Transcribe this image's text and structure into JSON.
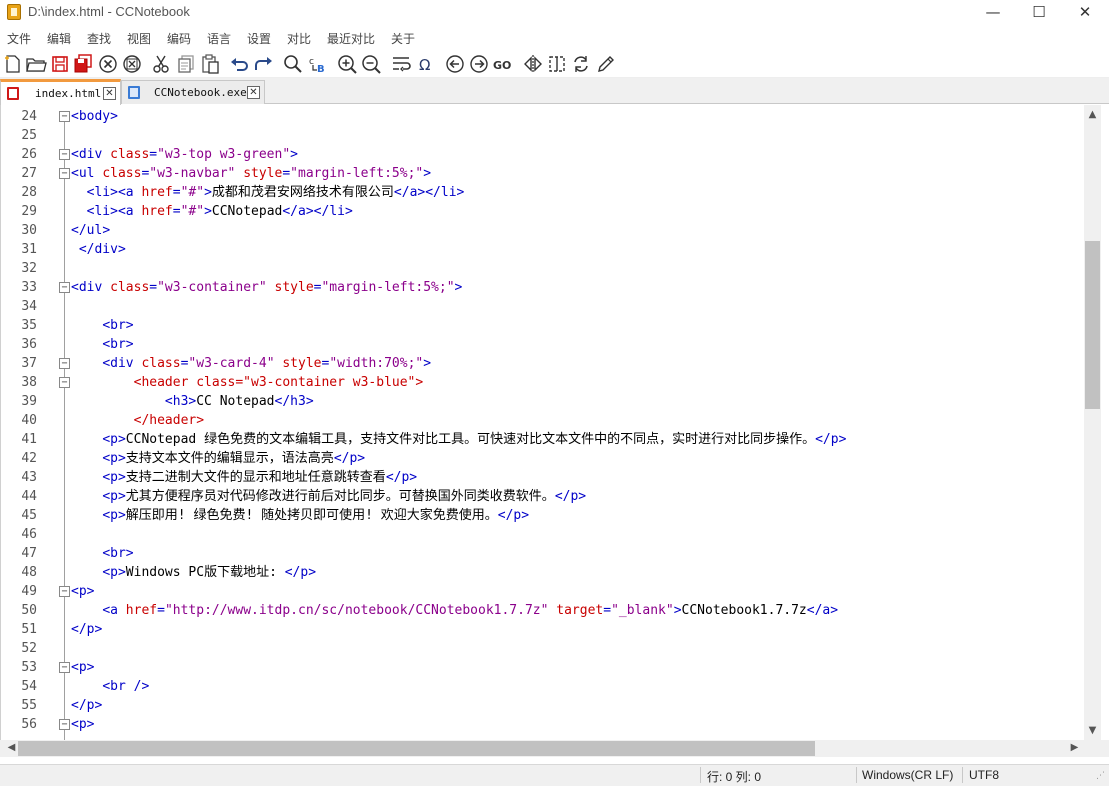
{
  "window": {
    "title": "D:\\index.html - CCNotebook",
    "minimize": "—",
    "maximize": "☐",
    "close": "✕"
  },
  "menu": {
    "items": [
      "文件",
      "编辑",
      "查找",
      "视图",
      "编码",
      "语言",
      "设置",
      "对比",
      "最近对比",
      "关于"
    ]
  },
  "toolbar": {
    "icons": [
      "new-file-icon",
      "open-folder-icon",
      "save-icon",
      "save-all-icon",
      "close-icon",
      "close-all-icon",
      "cut-icon",
      "copy-icon",
      "paste-icon",
      "undo-icon",
      "redo-icon",
      "find-icon",
      "replace-icon",
      "zoom-in-icon",
      "zoom-out-icon",
      "word-wrap-icon",
      "special-char-icon",
      "back-icon",
      "forward-icon",
      "goto-icon",
      "compare-icon",
      "select-icon",
      "refresh-icon",
      "edit-icon"
    ]
  },
  "tabs": [
    {
      "label": "index.html",
      "active": true,
      "icon": "html-file-icon"
    },
    {
      "label": "CCNotebook.exe",
      "active": false,
      "icon": "exe-file-icon"
    }
  ],
  "editor": {
    "line_numbers": [
      "24",
      "25",
      "26",
      "27",
      "28",
      "29",
      "30",
      "31",
      "32",
      "33",
      "34",
      "35",
      "36",
      "37",
      "38",
      "39",
      "40",
      "41",
      "42",
      "43",
      "44",
      "45",
      "46",
      "47",
      "48",
      "49",
      "50",
      "51",
      "52",
      "53",
      "54",
      "55",
      "56"
    ],
    "fold_markers": [
      "24",
      "26",
      "27",
      "33",
      "37",
      "38",
      "49",
      "53",
      "56"
    ],
    "lines": [
      "<body>",
      "",
      "<div class=\"w3-top w3-green\">",
      "<ul class=\"w3-navbar\" style=\"margin-left:5%;\">",
      "  <li><a href=\"#\">成都和茂君安网络技术有限公司</a></li>",
      "  <li><a href=\"#\">CCNotepad</a></li>",
      "</ul>",
      " </div>",
      "",
      "<div class=\"w3-container\" style=\"margin-left:5%;\">",
      "",
      "    <br>",
      "    <br>",
      "    <div class=\"w3-card-4\" style=\"width:70%;\">",
      "        <header class=\"w3-container w3-blue\">",
      "            <h3>CC Notepad</h3>",
      "        </header>",
      "    <p>CCNotepad 绿色免费的文本编辑工具，支持文件对比工具。可快速对比文本文件中的不同点，实时进行对比同步操作。</p>",
      "    <p>支持文本文件的编辑显示，语法高亮</p>",
      "    <p>支持二进制大文件的显示和地址任意跳转查看</p>",
      "    <p>尤其方便程序员对代码修改进行前后对比同步。可替换国外同类收费软件。</p>",
      "    <p>解压即用! 绿色免费! 随处拷贝即可使用! 欢迎大家免费使用。</p>",
      "",
      "    <br>",
      "    <p>Windows PC版下载地址: </p>",
      "<p>",
      "    <a href=\"http://www.itdp.cn/sc/notebook/CCNotebook1.7.7z\" target=\"_blank\">CCNotebook1.7.7z</a>",
      "</p>",
      "",
      "<p>",
      "    <br />",
      "</p>",
      "<p>"
    ]
  },
  "status": {
    "position": "行: 0 列: 0",
    "line_ending": "Windows(CR LF)",
    "encoding": "UTF8"
  }
}
